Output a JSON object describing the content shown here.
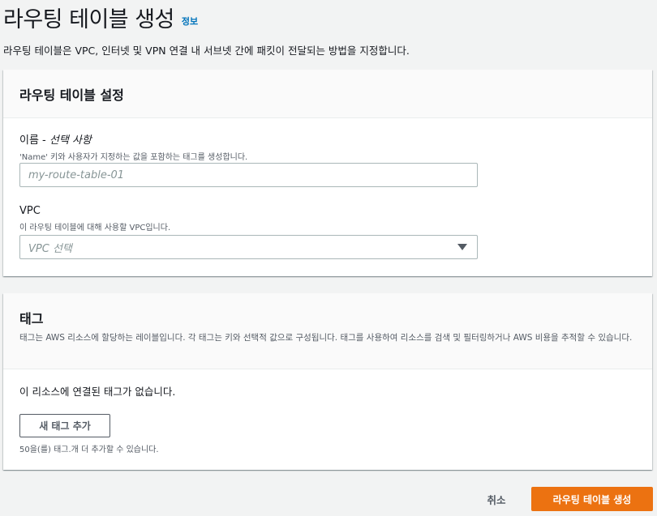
{
  "page": {
    "title": "라우팅 테이블 생성",
    "info_link": "정보",
    "description": "라우팅 테이블은 VPC, 인터넷 및 VPN 연결 내 서브넷 간에 패킷이 전달되는 방법을 지정합니다."
  },
  "settings": {
    "title": "라우팅 테이블 설정",
    "name_field": {
      "label": "이름 - ",
      "label_optional": "선택 사항",
      "description": "'Name' 키와 사용자가 지정하는 값을 포함하는 태그를 생성합니다.",
      "value": "",
      "placeholder": "my-route-table-01"
    },
    "vpc_field": {
      "label": "VPC",
      "description": "이 라우팅 테이블에 대해 사용할 VPC입니다.",
      "selected": "VPC 선택"
    }
  },
  "tags": {
    "title": "태그",
    "description": "태그는 AWS 리소스에 할당하는 레이블입니다. 각 태그는 키와 선택적 값으로 구성됩니다. 태그를 사용하여 리소스를 검색 및 필터링하거나 AWS 비용을 추적할 수 있습니다.",
    "empty_message": "이 리소스에 연결된 태그가 없습니다.",
    "add_button": "새 태그 추가",
    "limit_text": "50을(를) 태그.개 더 추가할 수 있습니다."
  },
  "footer": {
    "cancel": "취소",
    "create": "라우팅 테이블 생성"
  },
  "colors": {
    "primary": "#ec7211",
    "link": "#0073bb",
    "background": "#f2f3f3"
  },
  "icons": {
    "vpc_select": "caret-down-icon"
  }
}
